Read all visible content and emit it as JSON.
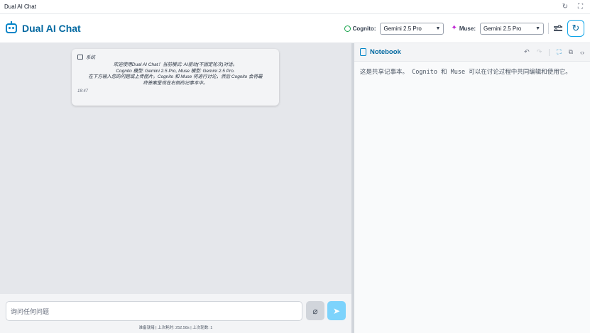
{
  "window": {
    "title": "Dual AI Chat",
    "reload_glyph": "↻",
    "fullscreen_glyph": "⛶"
  },
  "header": {
    "app_title": "Dual AI Chat",
    "cognito": {
      "label": "Cognito:",
      "selected": "Gemini 2.5 Pro"
    },
    "muse": {
      "label": "Muse:",
      "selected": "Gemini 2.5 Pro"
    }
  },
  "chat": {
    "message": {
      "sender": "系统",
      "lines": [
        "欢迎使用Dual AI Chat！当前模式: AI驱动(不固定轮次)对话。",
        "Cognito 模型: Gemini 2.5 Pro, Muse 模型: Gemini 2.5 Pro.",
        "在下方输入您的问题或上传图片。Cognito 和 Muse 将进行讨论，然后 Cognito 会将最",
        "终答案呈现在右侧的记事本中。"
      ],
      "time": "18:47"
    },
    "input": {
      "placeholder": "询问任何问题"
    },
    "status": "准备就绪 | 上次耗时: 252.58s | 上次轮数: 1"
  },
  "notebook": {
    "title": "Notebook",
    "content": "这是共享记事本。 Cognito 和 Muse 可以在讨论过程中共同编辑和使用它。"
  },
  "colors": {
    "accent": "#0369a1",
    "cognito": "#16a34a",
    "muse": "#c026d3",
    "send": "#7dd3fc"
  },
  "icons": [
    "reload-icon",
    "fullscreen-icon",
    "robot-logo-icon",
    "cognito-icon",
    "muse-sparkle-icon",
    "settings-sliders-icon",
    "reset-refresh-icon",
    "system-message-icon",
    "attach-paperclip-icon",
    "send-icon",
    "notebook-icon",
    "undo-icon",
    "redo-icon",
    "expand-icon",
    "copy-icon",
    "code-icon"
  ]
}
